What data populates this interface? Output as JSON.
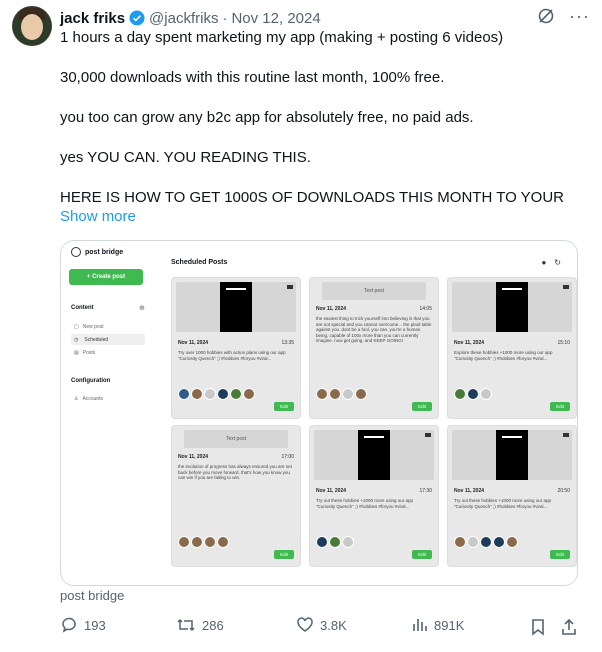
{
  "author": {
    "name": "jack friks",
    "handle": "@jackfriks",
    "date": "Nov 12, 2024"
  },
  "tweet": {
    "paragraphs": [
      "1 hours a day spent marketing my app (making + posting 6 videos)",
      "30,000 downloads with this routine last month, 100% free.",
      "you too can grow any b2c app for absolutely free, no paid ads.",
      "yes YOU CAN. YOU READING THIS.",
      "HERE IS HOW TO GET 1000S OF DOWNLOADS THIS MONTH TO YOUR"
    ],
    "show_more": "Show more"
  },
  "embed": {
    "app_name": "post bridge",
    "create_label": "+ Create post",
    "content_heading": "Content",
    "nav": [
      "New post",
      "Scheduled",
      "Posts"
    ],
    "config_heading": "Configuration",
    "config_nav": [
      "Accounts"
    ],
    "page_title": "Scheduled Posts",
    "posts": [
      {
        "media": "video",
        "date": "Nov 11, 2024",
        "time": "13:35",
        "text": "Try over 1000 hobbies with action plans using our app \"Curiosity Quench\" ;) #hobbies #foryou #viral...",
        "edit": "Edit"
      },
      {
        "media": "text",
        "media_label": "Text post",
        "date": "Nov 11, 2024",
        "time": "14:05",
        "text": "the easiest thing to trick yourself into believing is that you are not special and you cannot overcome... the plaid table against you. dont be a fool, you can. you're a human being, capable of 100x more than you can currently imagine. now get going, and KEEP GOING!",
        "edit": "Edit"
      },
      {
        "media": "video",
        "date": "Nov 11, 2024",
        "time": "15:10",
        "text": "Explore these hobbies +1000 more using our app \"Curiosity Quench\" ;) #hobbies #foryou #viral...",
        "edit": "Edit"
      },
      {
        "media": "text",
        "media_label": "Text post",
        "date": "Nov 11, 2024",
        "time": "17:00",
        "text": "the evolution of progress has always ensured you are set back before you move forward. that's how you know you can win if you are failing to win.",
        "edit": "Edit"
      },
      {
        "media": "video",
        "date": "Nov 11, 2024",
        "time": "17:30",
        "text": "Try out these hobbies +1000 more using our app \"Curiosity Quench\" ;) #hobbies #foryou #viral...",
        "edit": "Edit"
      },
      {
        "media": "video",
        "date": "Nov 11, 2024",
        "time": "20:50",
        "text": "Try out these hobbies +1000 more using our app \"Curiosity Quench\" ;) #hobbies #foryou #viral...",
        "edit": "Edit"
      }
    ]
  },
  "card_caption": "post bridge",
  "stats": {
    "replies": "193",
    "reposts": "286",
    "likes": "3.8K",
    "views": "891K"
  }
}
